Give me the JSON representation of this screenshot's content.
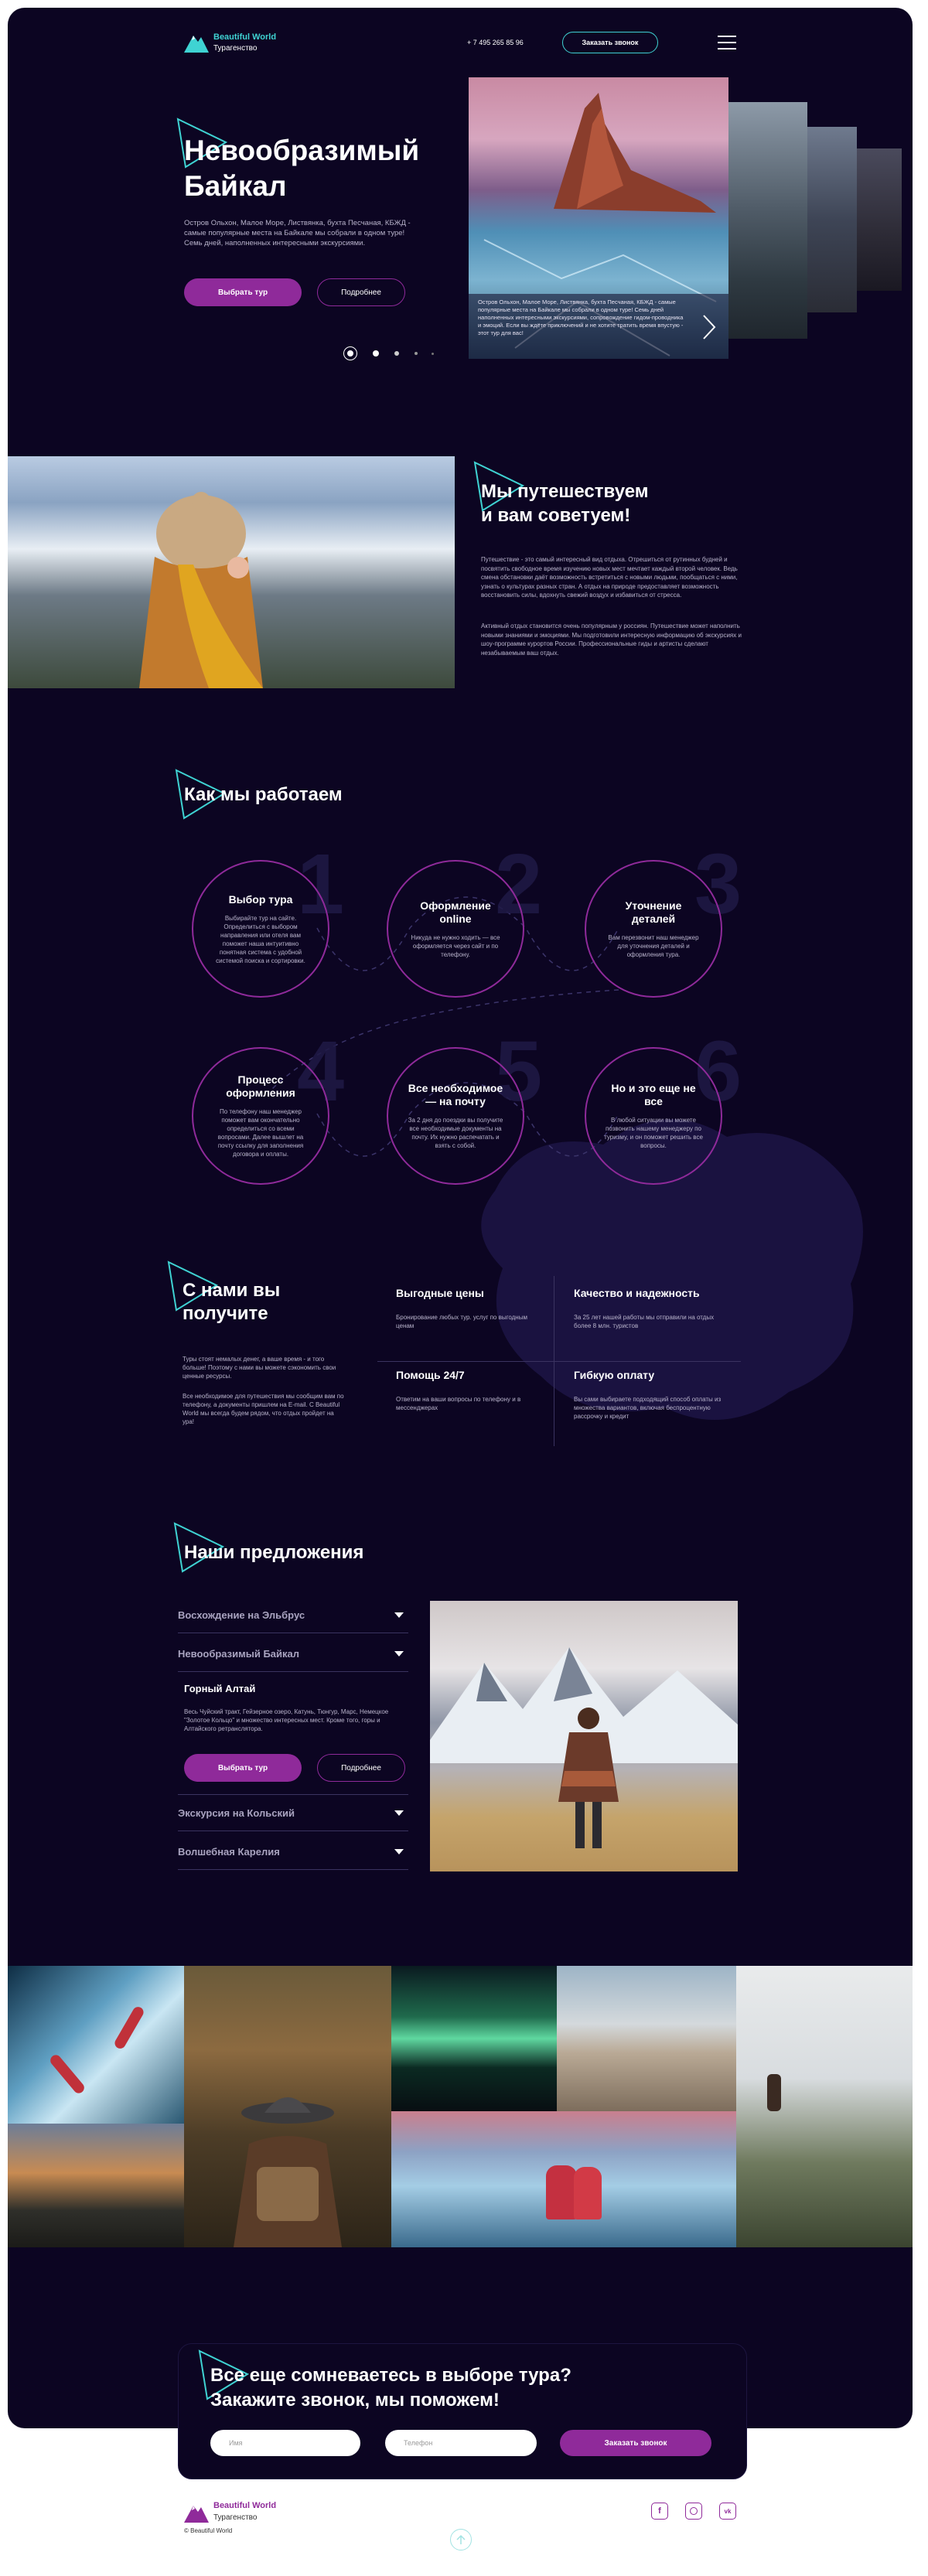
{
  "header": {
    "logo_title": "Beautiful World",
    "logo_subtitle": "Турагенство",
    "phone": "+ 7 495 265 85 96",
    "callback_button": "Заказать звонок",
    "menu_icon": "hamburger-icon"
  },
  "hero": {
    "title_line1": "Невообразимый",
    "title_line2": "Байкал",
    "description": "Остров Ольхон, Малое Море, Листвянка, бухта Песчаная, КБЖД - самые популярные места на Байкале мы собрали в одном туре! Семь дней, наполненных интересными экскурсиями.",
    "btn_primary": "Выбрать тур",
    "btn_secondary": "Подробнее",
    "slide_caption": "Остров Ольхон, Малое Море, Листвянка, бухта Песчаная, КБЖД - самые популярные места на Байкале мы собрали в одном туре! Семь дней наполненных интересными экскурсиями, сопровождение гидом-проводника и эмоций. Если вы ждёте приключений и не хотите тратить время впустую - этот тур для вас!"
  },
  "about": {
    "title_line1": "Мы путешествуем",
    "title_line2": "и вам советуем!",
    "para1": "Путешествие - это самый интересный вид отдыха. Отрешиться от рутинных будней и посвятить свободное время изучению новых мест мечтает каждый второй человек. Ведь смена обстановки даёт возможность встретиться с новыми людьми, пообщаться с ними, узнать о культурах разных стран. А отдых на природе предоставляет возможность восстановить силы, вдохнуть свежий воздух и избавиться от стресса.",
    "para2": "Активный отдых становится очень популярным у россиян. Путешествие может наполнить новыми знаниями и эмоциями. Мы подготовили интересную информацию об экскурсиях и шоу-программе курортов России. Профессиональные гиды и артисты сделают незабываемым ваш отдых."
  },
  "how": {
    "title": "Как мы работаем",
    "steps": [
      {
        "num": "1",
        "title": "Выбор тура",
        "desc": "Выбирайте тур на сайте. Определиться с выбором направления или отеля вам поможет наша интуитивно понятная система с удобной системой поиска и сортировки."
      },
      {
        "num": "2",
        "title": "Оформление online",
        "desc": "Никуда не нужно ходить — все оформляется через сайт и по телефону."
      },
      {
        "num": "3",
        "title": "Уточнение деталей",
        "desc": "Вам перезвонит наш менеджер для уточнения деталей и оформления тура."
      },
      {
        "num": "4",
        "title": "Процесс оформления",
        "desc": "По телефону наш менеджер поможет вам окончательно определиться со всеми вопросами. Далее вышлет на почту ссылку для заполнения договора и оплаты."
      },
      {
        "num": "5",
        "title": "Все необходимое — на почту",
        "desc": "За 2 дня до поездки вы получите все необходимые документы на почту. Их нужно распечатать и взять с собой."
      },
      {
        "num": "6",
        "title": "Но и это еще не все",
        "desc": "В любой ситуации вы можете позвонить нашему менеджеру по туризму, и он поможет решить все вопросы."
      }
    ]
  },
  "benefits": {
    "title_line1": "С нами вы",
    "title_line2": "получите",
    "para1": "Туры стоят немалых денег, а ваше время - и того больше! Поэтому с нами вы можете сэкономить свои ценные ресурсы.",
    "para2": "Все необходимое для путешествия мы сообщим вам по телефону, а документы пришлем на E-mail. С Beautiful World мы всегда будем рядом, что отдых пройдет на ура!",
    "items": [
      {
        "title": "Выгодные цены",
        "desc": "Бронирование любых тур. услуг по выгодным ценам"
      },
      {
        "title": "Качество и надежность",
        "desc": "За 25 лет нашей работы мы отправили на отдых более 8 млн. туристов"
      },
      {
        "title": "Помощь 24/7",
        "desc": "Ответим на ваши вопросы по телефону и в мессенджерах"
      },
      {
        "title": "Гибкую оплату",
        "desc": "Вы сами выбираете подходящий способ оплаты из множества вариантов, включая беспроцентную рассрочку и кредит"
      }
    ]
  },
  "offers": {
    "title": "Наши предложения",
    "items": [
      "Восхождение на Эльбрус",
      "Невообразимый Байкал"
    ],
    "open_title": "Горный Алтай",
    "open_desc": "Весь Чуйский тракт, Гейзерное озеро, Катунь, Тюнгур, Марс, Немецкое \"Золотое Кольцо\" и множество интересных мест. Кроме того, горы и Алтайского ретранслятора.",
    "btn_primary": "Выбрать тур",
    "btn_secondary": "Подробнее",
    "items_after": [
      "Экскурсия на Кольский",
      "Волшебная Карелия"
    ]
  },
  "cta": {
    "title_line1": "Все еще сомневаетесь в выборе тура?",
    "title_line2": "Закажите звонок, мы поможем!",
    "name_placeholder": "Имя",
    "phone_placeholder": "Телефон",
    "submit": "Заказать звонок"
  },
  "footer": {
    "logo_title": "Beautiful World",
    "logo_subtitle": "Турагенство",
    "copyright": "© Beautiful World",
    "socials": [
      "facebook-icon",
      "instagram-icon",
      "vk-icon"
    ]
  },
  "colors": {
    "background": "#0c0522",
    "accent": "#8f2a9a",
    "teal": "#3fd3d3"
  }
}
